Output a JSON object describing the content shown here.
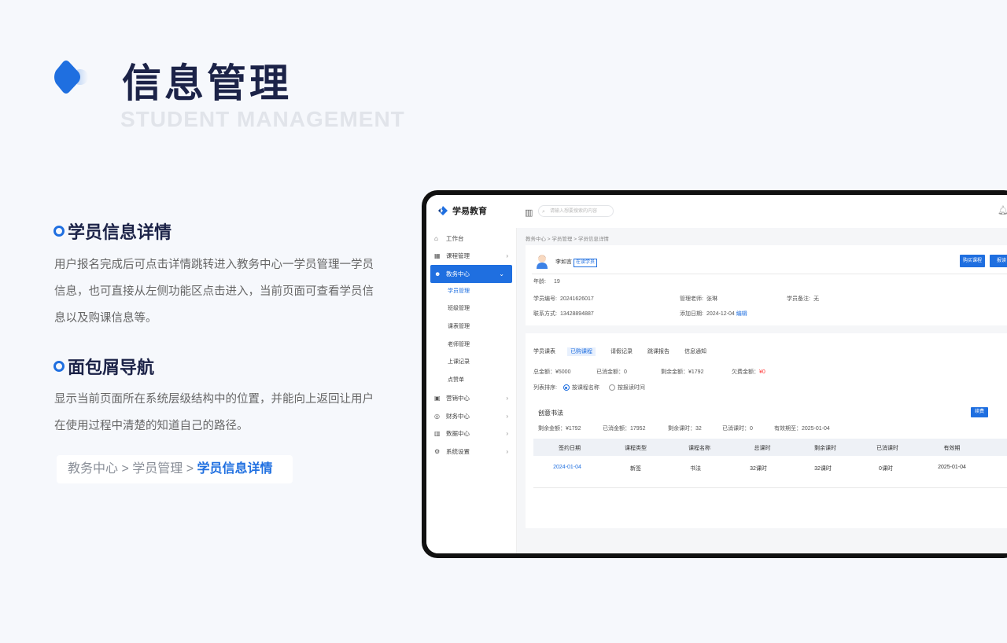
{
  "header": {
    "title": "信息管理",
    "subtitle": "STUDENT MANAGEMENT"
  },
  "section1": {
    "title": "学员信息详情",
    "text": "用户报名完成后可点击详情跳转进入教务中心一学员管理一学员信息，也可直接从左侧功能区点击进入，当前页面可查看学员信息以及购课信息等。"
  },
  "section2": {
    "title": "面包屑导航",
    "text": "显示当前页面所在系统层级结构中的位置，并能向上返回让用户在使用过程中清楚的知道自己的路径。"
  },
  "breadcrumb_demo": {
    "a": "教务中心",
    "sep": ">",
    "b": "学员管理",
    "c": "学员信息详情"
  },
  "app": {
    "brand": "学易教育",
    "search_placeholder": "请输入想要搜索的内容",
    "nav": [
      {
        "label": "工作台",
        "icon": "⌂"
      },
      {
        "label": "课程管理",
        "icon": "▦",
        "arrow": "›"
      },
      {
        "label": "教务中心",
        "icon": "☻",
        "arrow": "⌄"
      }
    ],
    "subnav": [
      "学员管理",
      "班级管理",
      "课表管理",
      "老师管理",
      "上课记录",
      "点赞单"
    ],
    "nav2": [
      {
        "label": "营销中心",
        "icon": "▣",
        "arrow": "›"
      },
      {
        "label": "财务中心",
        "icon": "◎",
        "arrow": "›"
      },
      {
        "label": "数据中心",
        "icon": "▥",
        "arrow": "›"
      },
      {
        "label": "系统设置",
        "icon": "⚙",
        "arrow": "›"
      }
    ],
    "crumb": "教务中心 > 学员管理 > 学员信息详情",
    "student": {
      "name": "李如言",
      "tag": "在读学员",
      "age_label": "年龄:",
      "age": "19",
      "id_label": "学员编号:",
      "id": "20241626017",
      "teacher_label": "管理老师:",
      "teacher": "张琳",
      "remark_label": "学员备注:",
      "remark": "无",
      "contact_label": "联系方式:",
      "contact": "13428894887",
      "date_label": "添加日期:",
      "date": "2024-12-04",
      "edit": "编辑",
      "buy_btn": "购买课程",
      "btn2": "报读"
    },
    "tabs": [
      "学员课表",
      "已购课程",
      "请假记录",
      "跳课报告",
      "信息通知"
    ],
    "summary": {
      "total": "总金额：¥5000",
      "consumed": "已消金额：0",
      "remaining": "剩余金额：¥1792",
      "owed_label": "欠费金额：",
      "owed": "¥0"
    },
    "sort": {
      "label": "列表排序:",
      "opt1": "按课程名称",
      "opt2": "按报读时间"
    },
    "course": {
      "name": "创意书法",
      "btn": "续费",
      "stats": [
        "剩余金额：¥1792",
        "已消金额：17952",
        "剩余课时：32",
        "已消课时：0",
        "有效期至：2025-01-04"
      ]
    },
    "table": {
      "headers": [
        "签约日期",
        "课程类型",
        "课程名称",
        "总课时",
        "剩余课时",
        "已消课时",
        "有效期"
      ],
      "rows": [
        [
          "2024-01-04",
          "新签",
          "书法",
          "32课时",
          "32课时",
          "0课时",
          "2025-01-04"
        ]
      ]
    }
  },
  "colors": {
    "accent": "#1f6fe0",
    "title": "#1c2348"
  }
}
